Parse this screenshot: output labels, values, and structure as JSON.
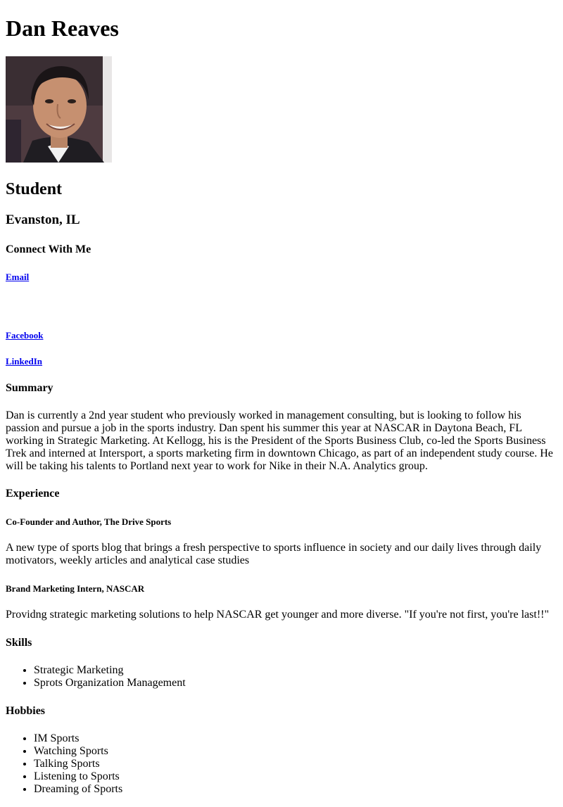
{
  "profile": {
    "name": "Dan Reaves",
    "title": "Student",
    "location": "Evanston, IL"
  },
  "connect": {
    "heading": "Connect With Me",
    "email": "Email",
    "facebook": "Facebook",
    "linkedin": "LinkedIn"
  },
  "summary": {
    "heading": "Summary",
    "text": "Dan is currently a 2nd year student who previously worked in management consulting, but is looking to follow his passion and pursue a job in the sports industry. Dan spent his summer this year at NASCAR in Daytona Beach, FL working in Strategic Marketing. At Kellogg, his is the President of the Sports Business Club, co-led the Sports Business Trek and interned at Intersport, a sports marketing firm in downtown Chicago, as part of an independent study course. He will be taking his talents to Portland next year to work for Nike in their N.A. Analytics group."
  },
  "experience": {
    "heading": "Experience",
    "items": [
      {
        "title": "Co-Founder and Author, The Drive Sports",
        "description": "A new type of sports blog that brings a fresh perspective to sports influence in society and our daily lives through daily motivators, weekly articles and analytical case studies"
      },
      {
        "title": "Brand Marketing Intern, NASCAR",
        "description": "Providng strategic marketing solutions to help NASCAR get younger and more diverse. \"If you're not first, you're last!!\""
      }
    ]
  },
  "skills": {
    "heading": "Skills",
    "items": [
      "Strategic Marketing",
      "Sprots Organization Management"
    ]
  },
  "hobbies": {
    "heading": "Hobbies",
    "items": [
      "IM Sports",
      "Watching Sports",
      "Talking Sports",
      "Listening to Sports",
      "Dreaming of Sports"
    ]
  }
}
